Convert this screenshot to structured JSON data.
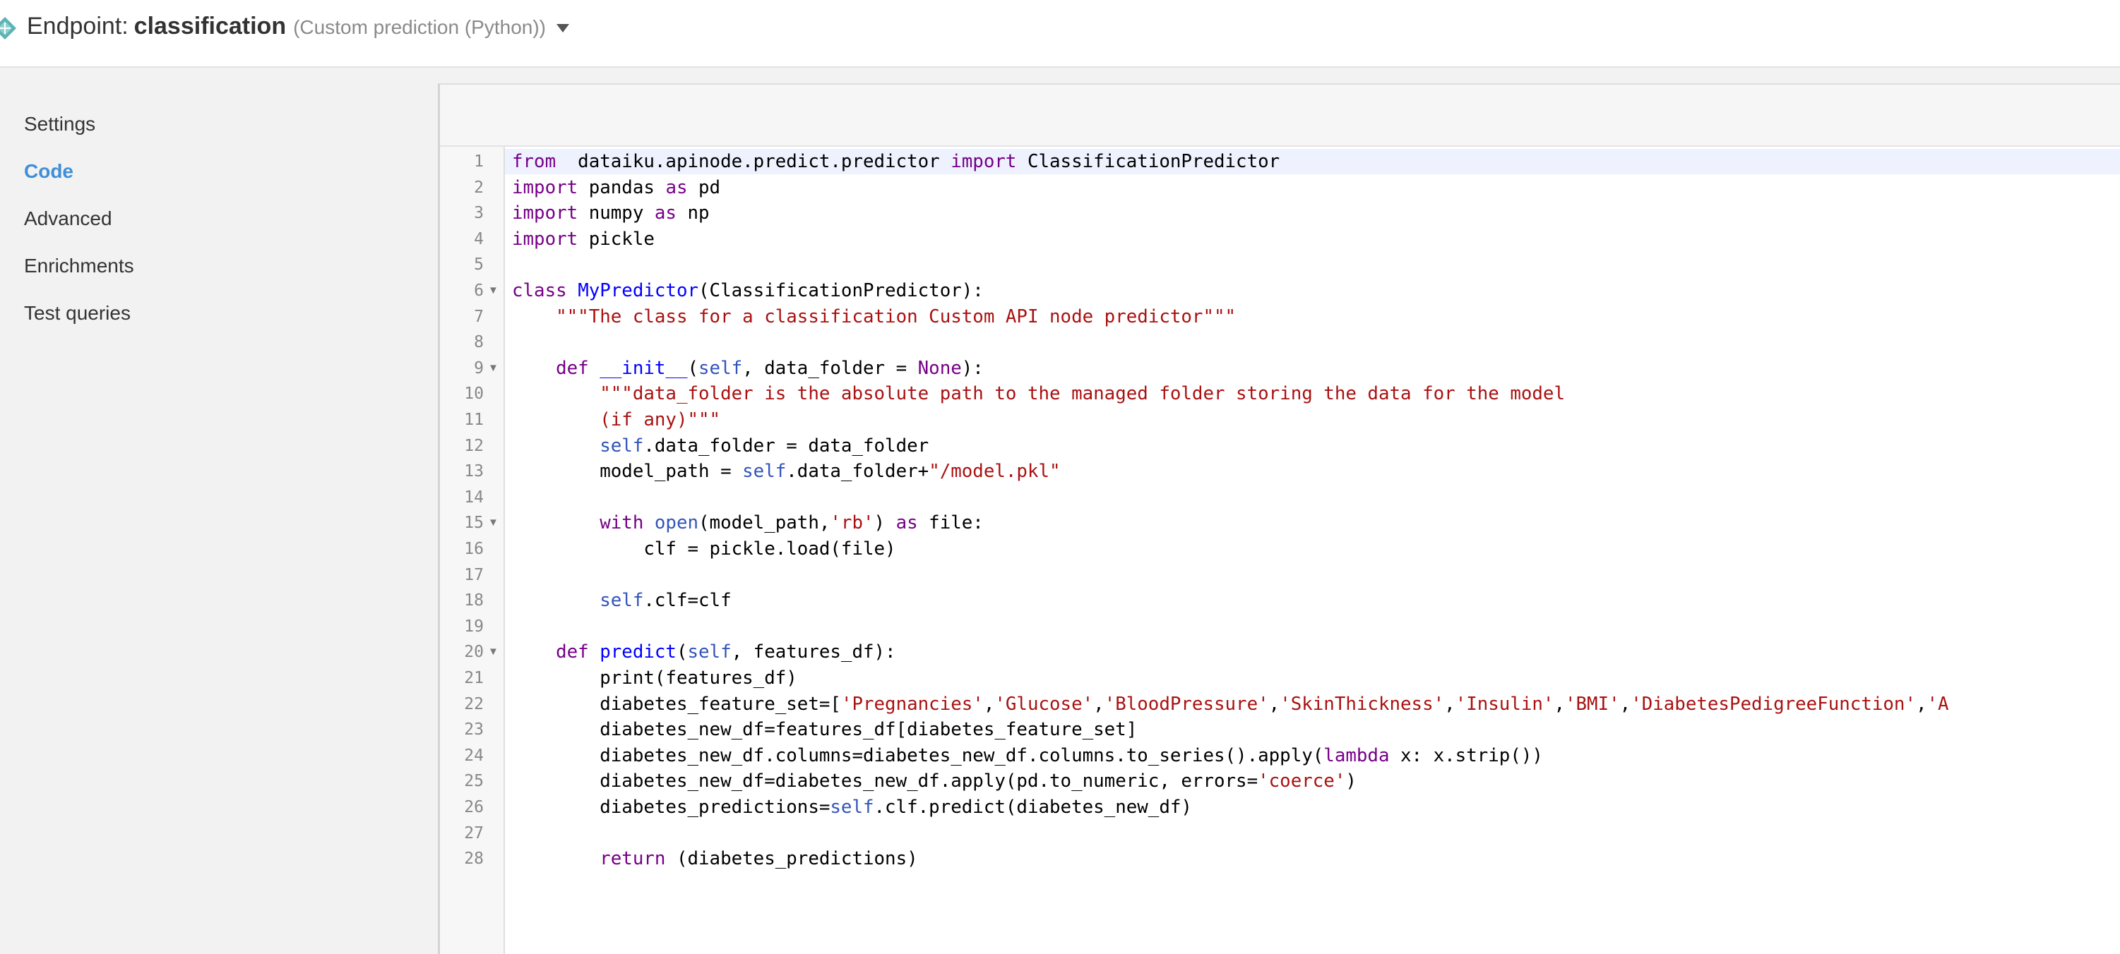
{
  "header": {
    "title_prefix": "Endpoint:",
    "endpoint_name": "classification",
    "endpoint_type": "(Custom prediction (Python))"
  },
  "sidebar": {
    "items": [
      {
        "label": "Settings",
        "active": false
      },
      {
        "label": "Code",
        "active": true
      },
      {
        "label": "Advanced",
        "active": false
      },
      {
        "label": "Enrichments",
        "active": false
      },
      {
        "label": "Test queries",
        "active": false
      }
    ]
  },
  "colors": {
    "accent": "#3e8fd8",
    "keyword": "#770088",
    "function": "#0000ff",
    "string": "#aa1111",
    "variable": "#3355bb"
  },
  "editor": {
    "active_line": 1,
    "fold_lines": [
      6,
      9,
      15,
      20
    ],
    "lines": [
      [
        {
          "k": "kw",
          "t": "from"
        },
        {
          "t": "  dataiku.apinode.predict.predictor "
        },
        {
          "k": "kw",
          "t": "import"
        },
        {
          "t": " ClassificationPredictor"
        }
      ],
      [
        {
          "k": "kw",
          "t": "import"
        },
        {
          "t": " pandas "
        },
        {
          "k": "kw",
          "t": "as"
        },
        {
          "t": " pd"
        }
      ],
      [
        {
          "k": "kw",
          "t": "import"
        },
        {
          "t": " numpy "
        },
        {
          "k": "kw",
          "t": "as"
        },
        {
          "t": " np"
        }
      ],
      [
        {
          "k": "kw",
          "t": "import"
        },
        {
          "t": " pickle"
        }
      ],
      [],
      [
        {
          "k": "kw",
          "t": "class"
        },
        {
          "t": " "
        },
        {
          "k": "fn",
          "t": "MyPredictor"
        },
        {
          "t": "(ClassificationPredictor):"
        }
      ],
      [
        {
          "t": "    "
        },
        {
          "k": "str",
          "t": "\"\"\"The class for a classification Custom API node predictor\"\"\""
        }
      ],
      [],
      [
        {
          "t": "    "
        },
        {
          "k": "kw",
          "t": "def"
        },
        {
          "t": " "
        },
        {
          "k": "fn",
          "t": "__init__"
        },
        {
          "t": "("
        },
        {
          "k": "var",
          "t": "self"
        },
        {
          "t": ", data_folder = "
        },
        {
          "k": "kw",
          "t": "None"
        },
        {
          "t": "):"
        }
      ],
      [
        {
          "t": "        "
        },
        {
          "k": "str",
          "t": "\"\"\"data_folder is the absolute path to the managed folder storing the data for the model"
        }
      ],
      [
        {
          "t": "        "
        },
        {
          "k": "str",
          "t": "(if any)\"\"\""
        }
      ],
      [
        {
          "t": "        "
        },
        {
          "k": "var",
          "t": "self"
        },
        {
          "t": ".data_folder = data_folder"
        }
      ],
      [
        {
          "t": "        model_path = "
        },
        {
          "k": "var",
          "t": "self"
        },
        {
          "t": ".data_folder+"
        },
        {
          "k": "str",
          "t": "\"/model.pkl\""
        }
      ],
      [],
      [
        {
          "t": "        "
        },
        {
          "k": "kw",
          "t": "with"
        },
        {
          "t": " "
        },
        {
          "k": "var",
          "t": "open"
        },
        {
          "t": "(model_path,"
        },
        {
          "k": "str",
          "t": "'rb'"
        },
        {
          "t": ") "
        },
        {
          "k": "kw",
          "t": "as"
        },
        {
          "t": " file:"
        }
      ],
      [
        {
          "t": "            clf = pickle.load(file)"
        }
      ],
      [],
      [
        {
          "t": "        "
        },
        {
          "k": "var",
          "t": "self"
        },
        {
          "t": ".clf=clf"
        }
      ],
      [],
      [
        {
          "t": "    "
        },
        {
          "k": "kw",
          "t": "def"
        },
        {
          "t": " "
        },
        {
          "k": "fn",
          "t": "predict"
        },
        {
          "t": "("
        },
        {
          "k": "var",
          "t": "self"
        },
        {
          "t": ", features_df):"
        }
      ],
      [
        {
          "t": "        print(features_df)"
        }
      ],
      [
        {
          "t": "        diabetes_feature_set=["
        },
        {
          "k": "str",
          "t": "'Pregnancies'"
        },
        {
          "t": ","
        },
        {
          "k": "str",
          "t": "'Glucose'"
        },
        {
          "t": ","
        },
        {
          "k": "str",
          "t": "'BloodPressure'"
        },
        {
          "t": ","
        },
        {
          "k": "str",
          "t": "'SkinThickness'"
        },
        {
          "t": ","
        },
        {
          "k": "str",
          "t": "'Insulin'"
        },
        {
          "t": ","
        },
        {
          "k": "str",
          "t": "'BMI'"
        },
        {
          "t": ","
        },
        {
          "k": "str",
          "t": "'DiabetesPedigreeFunction'"
        },
        {
          "t": ","
        },
        {
          "k": "str",
          "t": "'A"
        }
      ],
      [
        {
          "t": "        diabetes_new_df=features_df[diabetes_feature_set]"
        }
      ],
      [
        {
          "t": "        diabetes_new_df.columns=diabetes_new_df.columns.to_series().apply("
        },
        {
          "k": "kw",
          "t": "lambda"
        },
        {
          "t": " x: x.strip())"
        }
      ],
      [
        {
          "t": "        diabetes_new_df=diabetes_new_df.apply(pd.to_numeric, errors="
        },
        {
          "k": "str",
          "t": "'coerce'"
        },
        {
          "t": ")"
        }
      ],
      [
        {
          "t": "        diabetes_predictions="
        },
        {
          "k": "var",
          "t": "self"
        },
        {
          "t": ".clf.predict(diabetes_new_df)"
        }
      ],
      [],
      [
        {
          "t": "        "
        },
        {
          "k": "kw",
          "t": "return"
        },
        {
          "t": " (diabetes_predictions)"
        }
      ]
    ]
  }
}
